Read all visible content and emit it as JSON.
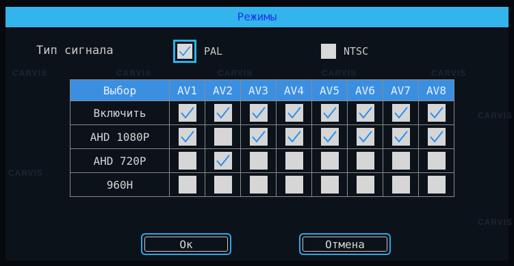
{
  "window": {
    "title": "Режимы"
  },
  "watermark": "CARVIS",
  "signal": {
    "label": "Тип сигнала",
    "options": [
      {
        "label": "PAL",
        "checked": true,
        "focused": true
      },
      {
        "label": "NTSC",
        "checked": false,
        "focused": false
      }
    ]
  },
  "table": {
    "header_label": "Выбор",
    "columns": [
      "AV1",
      "AV2",
      "AV3",
      "AV4",
      "AV5",
      "AV6",
      "AV7",
      "AV8"
    ],
    "rows": [
      {
        "label": "Включить",
        "values": [
          true,
          true,
          true,
          true,
          true,
          true,
          true,
          true
        ]
      },
      {
        "label": "AHD 1080P",
        "values": [
          true,
          false,
          true,
          true,
          true,
          true,
          true,
          true
        ]
      },
      {
        "label": "AHD 720P",
        "values": [
          false,
          true,
          false,
          false,
          false,
          false,
          false,
          false
        ]
      },
      {
        "label": "960H",
        "values": [
          false,
          false,
          false,
          false,
          false,
          false,
          false,
          false
        ]
      }
    ]
  },
  "buttons": {
    "ok": "Ок",
    "cancel": "Отмена"
  },
  "colors": {
    "title_bg": "#33b4ec",
    "header_bg": "#3b8fe1",
    "check": "#2a8ff0",
    "accent": "#2fa6ea"
  }
}
